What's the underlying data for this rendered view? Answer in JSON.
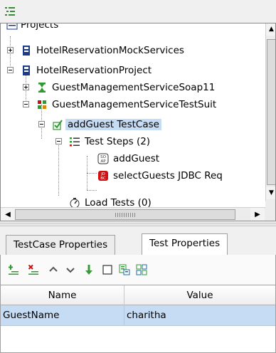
{
  "toolbar": {
    "icon": "tree-view-icon"
  },
  "tree": {
    "nodes": [
      {
        "label": "Projects",
        "icon": "projects-icon"
      },
      {
        "label": "HotelReservationMockServices",
        "icon": "project-icon",
        "expander": "collapsed"
      },
      {
        "label": "HotelReservationProject",
        "icon": "project-icon",
        "expander": "expanded"
      },
      {
        "label": "GuestManagementServiceSoap11",
        "icon": "interface-icon",
        "expander": "collapsed"
      },
      {
        "label": "GuestManagementServiceTestSuit",
        "icon": "testsuite-icon",
        "expander": "expanded"
      },
      {
        "label": "addGuest TestCase",
        "icon": "testcase-check-icon",
        "expander": "expanded",
        "selected": true
      },
      {
        "label": "Test Steps (2)",
        "icon": "teststeps-list-icon",
        "expander": "expanded"
      },
      {
        "label": "addGuest",
        "icon": "soap-request-icon"
      },
      {
        "label": "selectGuests JDBC Req",
        "icon": "jdbc-request-icon"
      },
      {
        "label": "Load Tests (0)",
        "icon": "load-test-icon"
      }
    ]
  },
  "tabs": [
    {
      "label": "TestCase Properties",
      "active": false
    },
    {
      "label": "Test Properties",
      "active": true
    }
  ],
  "props_toolbar": {
    "icons": [
      "add-property-icon",
      "remove-property-icon",
      "move-up-icon",
      "move-down-icon",
      "load-properties-icon",
      "blank-checkbox-icon",
      "save-properties-icon",
      "sort-properties-icon"
    ]
  },
  "grid": {
    "columns": [
      "Name",
      "Value"
    ],
    "rows": [
      {
        "name": "GuestName",
        "value": "charitha"
      }
    ]
  },
  "colors": {
    "selection": "#c5dcf4",
    "accent_green": "#2f9a2f",
    "accent_red": "#d01010"
  }
}
